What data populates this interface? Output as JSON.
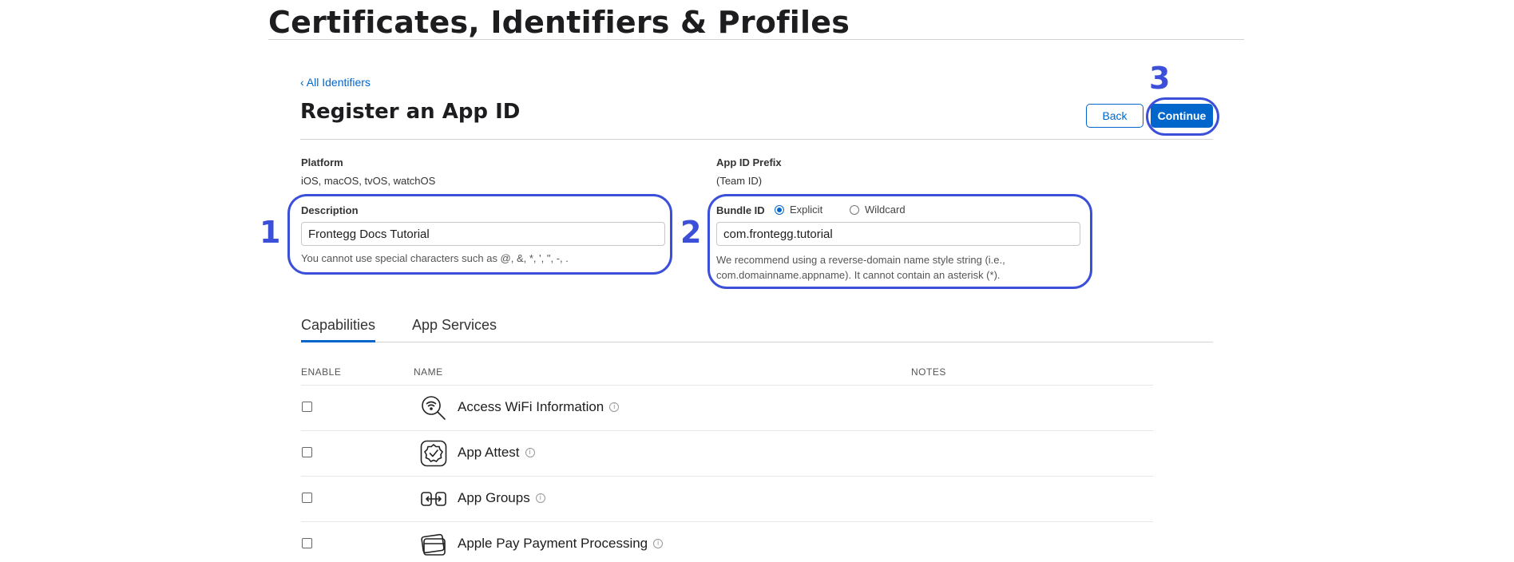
{
  "header": {
    "title": "Certificates, Identifiers & Profiles"
  },
  "nav": {
    "back_link": "‹ All Identifiers"
  },
  "section": {
    "title": "Register an App ID"
  },
  "buttons": {
    "back": "Back",
    "continue": "Continue"
  },
  "platform": {
    "label": "Platform",
    "value": "iOS, macOS, tvOS, watchOS"
  },
  "prefix": {
    "label": "App ID Prefix",
    "value": "(Team ID)"
  },
  "description": {
    "label": "Description",
    "value": "Frontegg Docs Tutorial",
    "help": "You cannot use special characters such as @, &, *, ', \", -, ."
  },
  "bundle": {
    "label": "Bundle ID",
    "explicit_label": "Explicit",
    "wildcard_label": "Wildcard",
    "selected": "Explicit",
    "value": "com.frontegg.tutorial",
    "help": "We recommend using a reverse-domain name style string (i.e., com.domainname.appname). It cannot contain an asterisk (*)."
  },
  "annotations": {
    "step1": "1",
    "step2": "2",
    "step3": "3",
    "color": "#3b4fd8"
  },
  "tabs": [
    {
      "label": "Capabilities",
      "active": true
    },
    {
      "label": "App Services",
      "active": false
    }
  ],
  "table": {
    "headers": {
      "enable": "ENABLE",
      "name": "NAME",
      "notes": "NOTES"
    },
    "rows": [
      {
        "name": "Access WiFi Information",
        "icon": "wifi-search-icon",
        "enabled": false
      },
      {
        "name": "App Attest",
        "icon": "badge-check-icon",
        "enabled": false
      },
      {
        "name": "App Groups",
        "icon": "app-groups-icon",
        "enabled": false
      },
      {
        "name": "Apple Pay Payment Processing",
        "icon": "wallet-icon",
        "enabled": false
      }
    ]
  },
  "colors": {
    "accent": "#0066cc",
    "text": "#1d1d1f",
    "rule": "#d2d2d7"
  }
}
